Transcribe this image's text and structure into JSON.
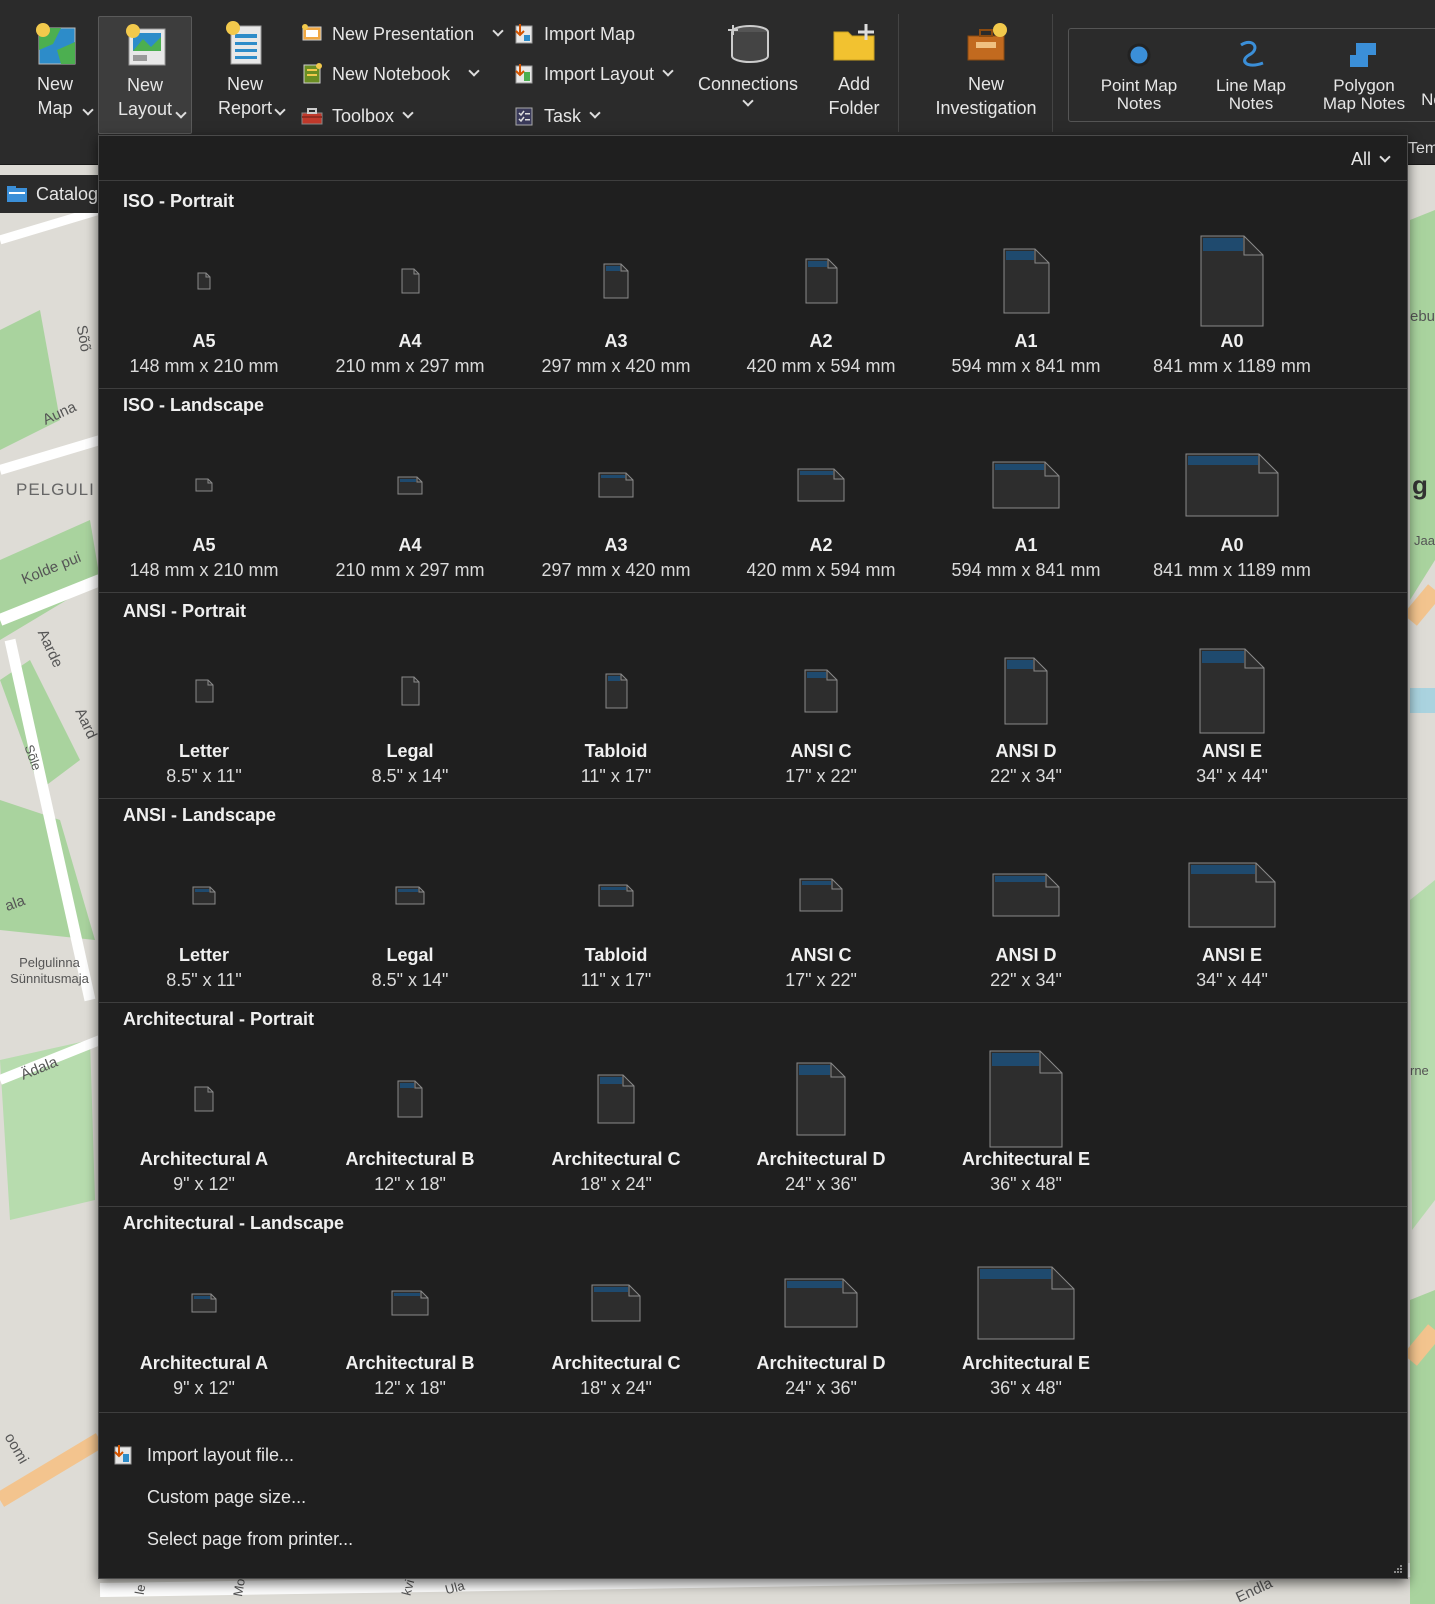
{
  "ribbon": {
    "new_map": "New Map",
    "new_layout": "New Layout",
    "new_report": "New Report",
    "new_presentation": "New Presentation",
    "new_notebook": "New Notebook",
    "toolbox": "Toolbox",
    "import_map": "Import Map",
    "import_layout": "Import Layout",
    "task": "Task",
    "connections": "Connections",
    "add_folder": "Add Folder",
    "new_investigation": "New Investigation",
    "notes": {
      "point": "Point Map Notes",
      "line": "Line Map Notes",
      "polygon": "Polygon Map Notes",
      "cut": "No"
    },
    "cut_tem": "Tem"
  },
  "catalog_tab": "Catalog",
  "map_labels": [
    "Sõõ",
    "Auna",
    "PELGULI",
    "Kolde pui",
    "Aarde",
    "Aard",
    "Sõle",
    "ala",
    "Pelgulinna Sünnitusmaja",
    "Ädala",
    "ebu",
    "g",
    "Jaa",
    "rne",
    "oomi",
    "le",
    "Mo",
    "kvi",
    "Ula",
    "Endla"
  ],
  "gallery": {
    "filter": "All",
    "sections": [
      {
        "title": "ISO - Portrait",
        "tiles": [
          {
            "name": "A5",
            "size": "148 mm x 210 mm"
          },
          {
            "name": "A4",
            "size": "210 mm x 297 mm"
          },
          {
            "name": "A3",
            "size": "297 mm x 420 mm"
          },
          {
            "name": "A2",
            "size": "420 mm x 594 mm"
          },
          {
            "name": "A1",
            "size": "594 mm x 841 mm"
          },
          {
            "name": "A0",
            "size": "841 mm x 1189 mm"
          }
        ]
      },
      {
        "title": "ISO - Landscape",
        "tiles": [
          {
            "name": "A5",
            "size": "148 mm x 210 mm"
          },
          {
            "name": "A4",
            "size": "210 mm x 297 mm"
          },
          {
            "name": "A3",
            "size": "297 mm x 420 mm"
          },
          {
            "name": "A2",
            "size": "420 mm x 594 mm"
          },
          {
            "name": "A1",
            "size": "594 mm x 841 mm"
          },
          {
            "name": "A0",
            "size": "841 mm x 1189 mm"
          }
        ]
      },
      {
        "title": "ANSI - Portrait",
        "tiles": [
          {
            "name": "Letter",
            "size": "8.5\" x 11\""
          },
          {
            "name": "Legal",
            "size": "8.5\" x 14\""
          },
          {
            "name": "Tabloid",
            "size": "11\" x 17\""
          },
          {
            "name": "ANSI C",
            "size": "17\" x 22\""
          },
          {
            "name": "ANSI D",
            "size": "22\" x 34\""
          },
          {
            "name": "ANSI E",
            "size": "34\" x 44\""
          }
        ]
      },
      {
        "title": "ANSI - Landscape",
        "tiles": [
          {
            "name": "Letter",
            "size": "8.5\" x 11\""
          },
          {
            "name": "Legal",
            "size": "8.5\" x 14\""
          },
          {
            "name": "Tabloid",
            "size": "11\" x 17\""
          },
          {
            "name": "ANSI C",
            "size": "17\" x 22\""
          },
          {
            "name": "ANSI D",
            "size": "22\" x 34\""
          },
          {
            "name": "ANSI E",
            "size": "34\" x 44\""
          }
        ]
      },
      {
        "title": "Architectural - Portrait",
        "tiles": [
          {
            "name": "Architectural A",
            "size": "9\" x 12\""
          },
          {
            "name": "Architectural B",
            "size": "12\" x 18\""
          },
          {
            "name": "Architectural C",
            "size": "18\" x 24\""
          },
          {
            "name": "Architectural D",
            "size": "24\" x 36\""
          },
          {
            "name": "Architectural E",
            "size": "36\" x 48\""
          }
        ]
      },
      {
        "title": "Architectural - Landscape",
        "tiles": [
          {
            "name": "Architectural A",
            "size": "9\" x 12\""
          },
          {
            "name": "Architectural B",
            "size": "12\" x 18\""
          },
          {
            "name": "Architectural C",
            "size": "18\" x 24\""
          },
          {
            "name": "Architectural D",
            "size": "24\" x 36\""
          },
          {
            "name": "Architectural E",
            "size": "36\" x 48\""
          }
        ]
      }
    ],
    "footer": {
      "import_layout_file": "Import layout file...",
      "custom_page_size": "Custom page size...",
      "select_from_printer": "Select page from printer..."
    }
  },
  "colors": {
    "ribbon_bg": "#2b2b2b",
    "gallery_bg": "#1f1f1f",
    "page_fill": "#2d2d2d",
    "page_accent": "#1f4a6e",
    "page_stroke": "#8a8a8a",
    "notes_blue": "#3b8fd8"
  }
}
